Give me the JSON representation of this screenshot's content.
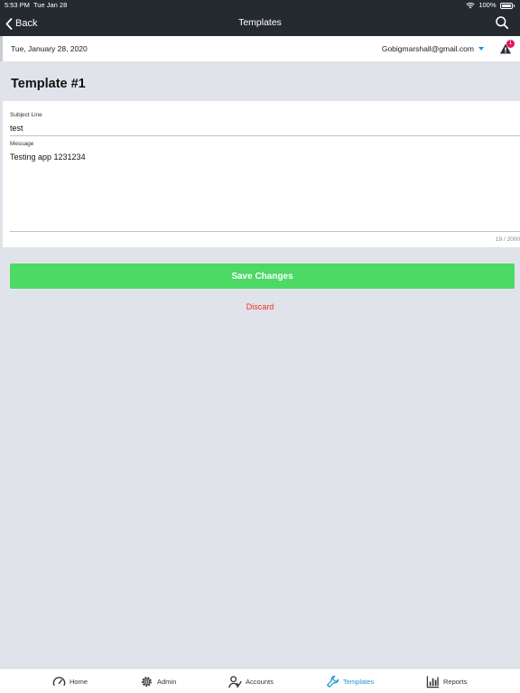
{
  "status": {
    "time": "5:53 PM",
    "date": "Tue Jan 28",
    "battery": "100%"
  },
  "nav": {
    "back_label": "Back",
    "title": "Templates"
  },
  "infobar": {
    "date": "Tue, January 28, 2020",
    "user_email": "Gobigmarshall@gmail.com",
    "alert_count": "1"
  },
  "page": {
    "title": "Template #1"
  },
  "form": {
    "subject_label": "Subject Line",
    "subject_value": "test",
    "message_label": "Message",
    "message_value": "Testing app 1231234",
    "counter": "19 / 2000"
  },
  "actions": {
    "save_label": "Save Changes",
    "discard_label": "Discard"
  },
  "tabs": [
    {
      "label": "Home",
      "icon": "speedometer-icon"
    },
    {
      "label": "Admin",
      "icon": "gear-icon"
    },
    {
      "label": "Accounts",
      "icon": "users-icon"
    },
    {
      "label": "Templates",
      "icon": "wrench-icon",
      "active": true
    },
    {
      "label": "Reports",
      "icon": "bar-chart-icon"
    }
  ],
  "colors": {
    "nav_bg": "#252a31",
    "accent": "#1a96d6",
    "save": "#4cd964",
    "discard": "#e8331e",
    "badge": "#e4145c"
  }
}
